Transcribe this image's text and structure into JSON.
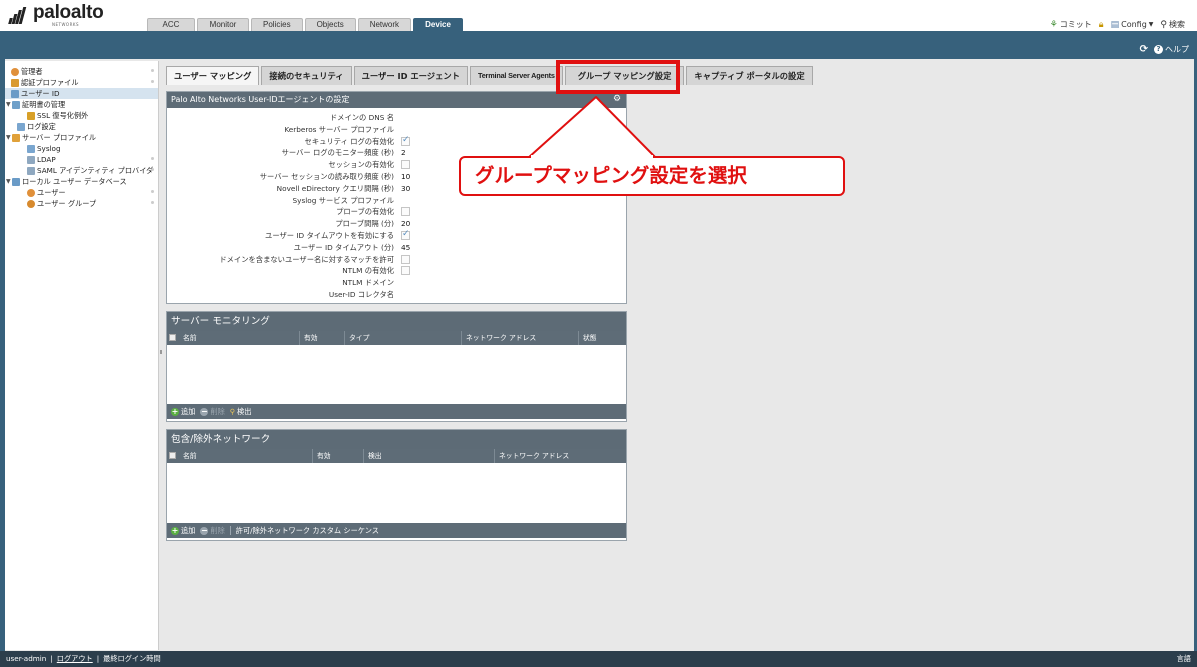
{
  "header": {
    "logo_text": "paloalto",
    "logo_sub": "NETWORKS",
    "tabs": [
      {
        "label": "ACC"
      },
      {
        "label": "Monitor"
      },
      {
        "label": "Policies"
      },
      {
        "label": "Objects"
      },
      {
        "label": "Network"
      },
      {
        "label": "Device"
      }
    ],
    "commit": "コミット",
    "config": "Config",
    "search": "検索"
  },
  "blue_bar": {
    "help": "ヘルプ"
  },
  "sidebar": {
    "items": [
      {
        "label": "管理者",
        "icon": "admin-icon"
      },
      {
        "label": "認証プロファイル",
        "icon": "auth-profile-icon"
      },
      {
        "label": "ユーザー ID",
        "icon": "user-id-icon"
      },
      {
        "label": "証明書の管理",
        "icon": "certificate-icon"
      },
      {
        "label": "SSL 復号化例外",
        "icon": "lock-icon"
      },
      {
        "label": "ログ設定",
        "icon": "log-icon"
      },
      {
        "label": "サーバー プロファイル",
        "icon": "server-profile-icon"
      },
      {
        "label": "Syslog",
        "icon": "syslog-icon"
      },
      {
        "label": "LDAP",
        "icon": "ldap-icon"
      },
      {
        "label": "SAML アイデンティティ プロバイダ",
        "icon": "saml-icon"
      },
      {
        "label": "ローカル ユーザー データベース",
        "icon": "database-icon"
      },
      {
        "label": "ユーザー",
        "icon": "user-icon"
      },
      {
        "label": "ユーザー グループ",
        "icon": "user-group-icon"
      }
    ]
  },
  "sub_tabs": [
    {
      "label": "ユーザー マッピング"
    },
    {
      "label": "接続のセキュリティ"
    },
    {
      "label": "ユーザー ID エージェント"
    },
    {
      "label": "Terminal Server Agents"
    },
    {
      "label": "グループ マッピング設定"
    },
    {
      "label": "キャプティブ ポータルの設定"
    }
  ],
  "agent_panel": {
    "title": "Palo Alto Networks User-IDエージェントの設定",
    "rows": [
      {
        "label": "ドメインの DNS 名",
        "value": ""
      },
      {
        "label": "Kerberos サーバー プロファイル",
        "value": ""
      },
      {
        "label": "セキュリティ ログの有効化",
        "checkbox": true,
        "checked": true
      },
      {
        "label": "サーバー ログのモニター頻度 (秒)",
        "value": "2"
      },
      {
        "label": "セッションの有効化",
        "checkbox": true,
        "checked": false
      },
      {
        "label": "サーバー セッションの読み取り頻度 (秒)",
        "value": "10"
      },
      {
        "label": "Novell eDirectory クエリ間隔 (秒)",
        "value": "30"
      },
      {
        "label": "Syslog サービス プロファイル",
        "value": ""
      },
      {
        "label": "プローブの有効化",
        "checkbox": true,
        "checked": false
      },
      {
        "label": "プローブ間隔 (分)",
        "value": "20"
      },
      {
        "label": "ユーザー ID タイムアウトを有効にする",
        "checkbox": true,
        "checked": true
      },
      {
        "label": "ユーザー ID タイムアウト (分)",
        "value": "45"
      },
      {
        "label": "ドメインを含まないユーザー名に対するマッチを許可",
        "checkbox": true,
        "checked": false
      },
      {
        "label": "NTLM の有効化",
        "checkbox": true,
        "checked": false
      },
      {
        "label": "NTLM ドメイン",
        "value": ""
      },
      {
        "label": "User-ID コレクタ名",
        "value": ""
      }
    ]
  },
  "server_monitor": {
    "title": "サーバー モニタリング",
    "columns": [
      "名前",
      "有効",
      "タイプ",
      "ネットワーク アドレス",
      "状態"
    ],
    "add": "追加",
    "delete": "削除",
    "detect": "検出"
  },
  "include_exclude": {
    "title": "包含/除外ネットワーク",
    "columns": [
      "名前",
      "有効",
      "検出",
      "ネットワーク アドレス"
    ],
    "add": "追加",
    "delete": "削除",
    "custom_seq": "許可/除外ネットワーク カスタム シーケンス"
  },
  "callout": {
    "text": "グループマッピング設定を選択"
  },
  "status_bar": {
    "user": "user-admin",
    "logout": "ログアウト",
    "last_login": "最終ログイン時間",
    "language": "言語"
  },
  "colors": {
    "brand_blue": "#37617c",
    "panel_header": "#5e6c77",
    "callout_red": "#e01010"
  }
}
